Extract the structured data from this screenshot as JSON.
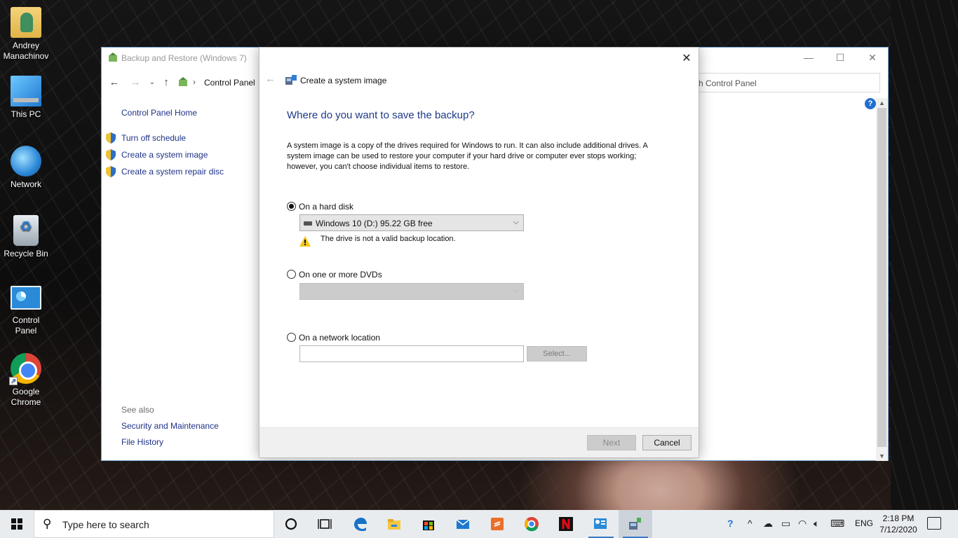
{
  "desktop": {
    "icons": [
      {
        "label": "Andrey Manachinov",
        "icon": "user-folder-icon"
      },
      {
        "label": "This PC",
        "icon": "computer-icon"
      },
      {
        "label": "Network",
        "icon": "network-icon"
      },
      {
        "label": "Recycle Bin",
        "icon": "recycle-bin-icon"
      },
      {
        "label": "Control Panel",
        "icon": "control-panel-icon"
      },
      {
        "label": "Google Chrome",
        "icon": "chrome-icon"
      }
    ]
  },
  "control_panel": {
    "title": "Backup and Restore (Windows 7)",
    "address": [
      "Control Panel"
    ],
    "search_placeholder": "ch Control Panel",
    "left_nav": {
      "home": "Control Panel Home",
      "tasks": [
        {
          "label": "Turn off schedule",
          "icon": "shield-icon"
        },
        {
          "label": "Create a system image",
          "icon": "shield-icon"
        },
        {
          "label": "Create a system repair disc",
          "icon": "shield-icon"
        }
      ],
      "see_also_heading": "See also",
      "see_also": [
        "Security and Maintenance",
        "File History"
      ]
    },
    "help": "?"
  },
  "dialog": {
    "title": "Create a system image",
    "heading": "Where do you want to save the backup?",
    "description": "A system image is a copy of the drives required for Windows to run. It can also include additional drives. A system image can be used to restore your computer if your hard drive or computer ever stops working; however, you can't choose individual items to restore.",
    "options": {
      "hard_disk": {
        "label": "On a hard disk",
        "selected": true,
        "drive": "Windows 10 (D:)  95.22 GB free",
        "warning": "The drive is not a valid backup location."
      },
      "dvds": {
        "label": "On one or more DVDs",
        "selected": false,
        "drive": ""
      },
      "network": {
        "label": "On a network location",
        "selected": false,
        "path": "",
        "select_button": "Select..."
      }
    },
    "buttons": {
      "next": "Next",
      "cancel": "Cancel"
    }
  },
  "taskbar": {
    "search_placeholder": "Type here to search",
    "pinned": [
      "cortana-icon",
      "task-view-icon",
      "edge-icon",
      "file-explorer-icon",
      "store-icon",
      "mail-icon",
      "sublime-icon",
      "chrome-icon",
      "netflix-icon",
      "control-panel-icon",
      "backup-icon"
    ],
    "language": "ENG",
    "time": "2:18 PM",
    "date": "7/12/2020"
  },
  "colors": {
    "link": "#1e3287",
    "heading": "#1e3a8a",
    "taskbar": "#e9ecef",
    "accent": "#3a78c8"
  }
}
